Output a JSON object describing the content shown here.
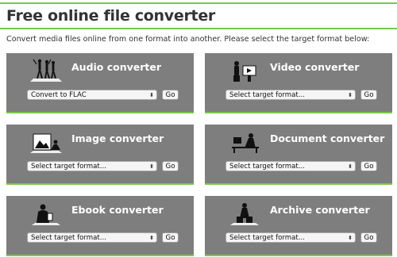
{
  "header": {
    "title": "Free online file converter"
  },
  "intro": "Convert media files online from one format into another. Please select the target format below:",
  "go_label": "Go",
  "cards": [
    {
      "heading": "Audio converter",
      "select_value": "Convert to FLAC",
      "icon": "audio-silhouette-icon"
    },
    {
      "heading": "Video converter",
      "select_value": "Select target format...",
      "icon": "video-silhouette-icon"
    },
    {
      "heading": "Image converter",
      "select_value": "Select target format...",
      "icon": "image-silhouette-icon"
    },
    {
      "heading": "Document converter",
      "select_value": "Select target format...",
      "icon": "document-silhouette-icon"
    },
    {
      "heading": "Ebook converter",
      "select_value": "Select target format...",
      "icon": "ebook-silhouette-icon"
    },
    {
      "heading": "Archive converter",
      "select_value": "Select target format...",
      "icon": "archive-silhouette-icon"
    }
  ],
  "colors": {
    "accent": "#7cc64a",
    "card_bg": "#7e7e7e"
  }
}
